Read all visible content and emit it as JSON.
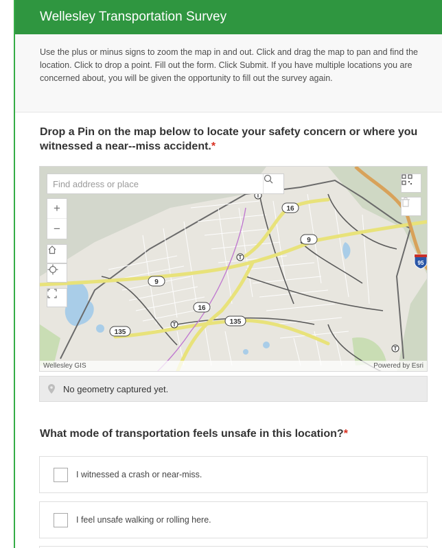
{
  "header": {
    "title": "Wellesley Transportation Survey"
  },
  "intro": {
    "text": "Use the plus or minus signs to zoom the map in and out. Click and drag the map to pan and find the location. Click to drop a point. Fill out the form. Click Submit. If you have multiple locations you are concerned about, you will be given the opportunity to fill out the survey again."
  },
  "question1": {
    "label": "Drop a Pin on the map below to locate your safety concern or where you witnessed a near--miss accident.",
    "required_mark": "*"
  },
  "map": {
    "search_placeholder": "Find address or place",
    "controls": {
      "zoom_in": "+",
      "zoom_out": "−"
    },
    "route_labels": {
      "r16a": "16",
      "r9a": "9",
      "r9b": "9",
      "r16b": "16",
      "r135a": "135",
      "r135b": "135",
      "i95": "95",
      "t": "T"
    },
    "attribution_left": "Wellesley GIS",
    "attribution_right": "Powered by Esri"
  },
  "geometry": {
    "status": "No geometry captured yet."
  },
  "question2": {
    "label": "What mode of transportation feels unsafe in this location?",
    "required_mark": "*",
    "options": [
      "I witnessed a crash or near-miss.",
      "I feel unsafe walking or rolling here."
    ]
  },
  "colors": {
    "header_bg": "#2f9640",
    "required": "#d83020",
    "highway": "#e8e27a",
    "water": "#a9cde8",
    "park": "#c9ddb4"
  }
}
